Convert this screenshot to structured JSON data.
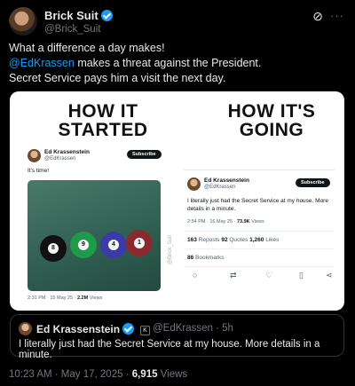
{
  "author": {
    "name": "Brick Suit",
    "handle": "@Brick_Suit"
  },
  "icons": {
    "grok": "grok-icon",
    "more": "more-icon",
    "verified": "verified-badge-icon"
  },
  "tweet": {
    "line1": "What a difference a day makes!",
    "mention": "@EdKrassen",
    "line2_rest": " makes a threat against the President.",
    "line3": "Secret Service pays him a visit the next day."
  },
  "meme": {
    "left_heading_1": "HOW IT",
    "left_heading_2": "STARTED",
    "right_heading_1": "HOW IT'S",
    "right_heading_2": "GOING",
    "left_tweet": {
      "name": "Ed Krassenstein",
      "handle": "@EdKrassen",
      "subscribe": "Subscribe",
      "text": "It's time!",
      "meta": "2:31 PM · 15 May 25 · ",
      "views": "2.2M",
      "views_label": " Views",
      "watermark": "@Brick_Suit",
      "balls": [
        "8",
        "9",
        "4",
        "1"
      ]
    },
    "right_tweet": {
      "name": "Ed Krassenstein",
      "handle": "@EdKrassen",
      "subscribe": "Subscribe",
      "text": "I literally just had the Secret Service at my house. More details in a minute.",
      "meta": "2:54 PM · 16 May 25 · ",
      "views": "73.9K",
      "views_label": " Views",
      "reposts_n": "163",
      "reposts_label": " Reposts  ",
      "quotes_n": "92",
      "quotes_label": " Quotes  ",
      "likes_n": "1,260",
      "likes_label": " Likes",
      "bookmarks_n": "86",
      "bookmarks_label": " Bookmarks"
    }
  },
  "quote": {
    "name": "Ed Krassenstein",
    "handle": "@EdKrassen · 5h",
    "text": "I literally just had the Secret Service at my house. More details in a minute."
  },
  "footer": {
    "time": "10:23 AM · May 17, 2025 · ",
    "views": "6,915",
    "views_label": " Views"
  }
}
